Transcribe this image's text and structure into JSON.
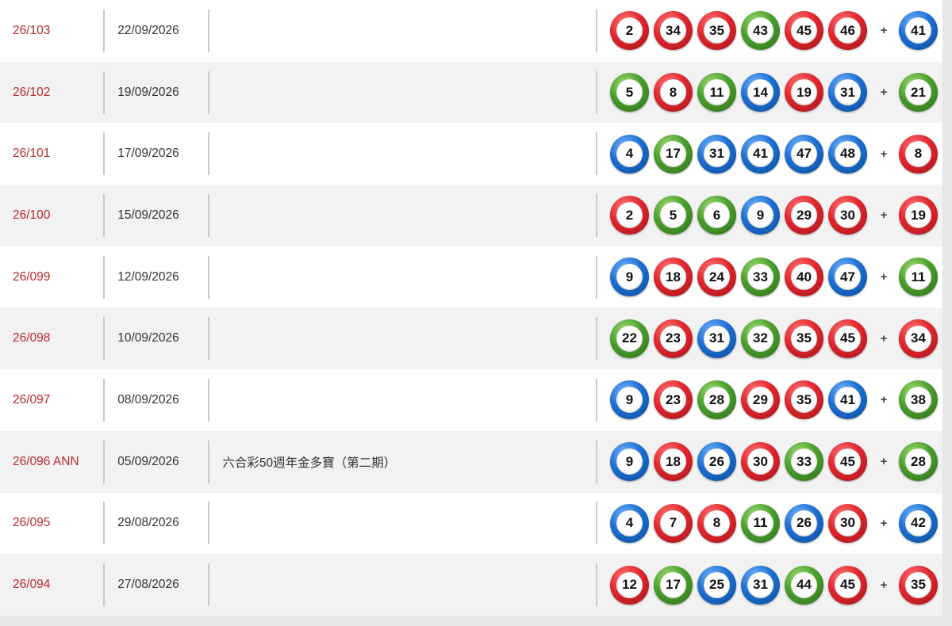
{
  "rows": [
    {
      "draw": "26/103",
      "date": "22/09/2026",
      "note": "",
      "balls": [
        {
          "n": "2",
          "c": "red"
        },
        {
          "n": "34",
          "c": "red"
        },
        {
          "n": "35",
          "c": "red"
        },
        {
          "n": "43",
          "c": "green"
        },
        {
          "n": "45",
          "c": "red"
        },
        {
          "n": "46",
          "c": "red"
        }
      ],
      "extra": {
        "n": "41",
        "c": "blue"
      }
    },
    {
      "draw": "26/102",
      "date": "19/09/2026",
      "note": "",
      "balls": [
        {
          "n": "5",
          "c": "green"
        },
        {
          "n": "8",
          "c": "red"
        },
        {
          "n": "11",
          "c": "green"
        },
        {
          "n": "14",
          "c": "blue"
        },
        {
          "n": "19",
          "c": "red"
        },
        {
          "n": "31",
          "c": "blue"
        }
      ],
      "extra": {
        "n": "21",
        "c": "green"
      }
    },
    {
      "draw": "26/101",
      "date": "17/09/2026",
      "note": "",
      "balls": [
        {
          "n": "4",
          "c": "blue"
        },
        {
          "n": "17",
          "c": "green"
        },
        {
          "n": "31",
          "c": "blue"
        },
        {
          "n": "41",
          "c": "blue"
        },
        {
          "n": "47",
          "c": "blue"
        },
        {
          "n": "48",
          "c": "blue"
        }
      ],
      "extra": {
        "n": "8",
        "c": "red"
      }
    },
    {
      "draw": "26/100",
      "date": "15/09/2026",
      "note": "",
      "balls": [
        {
          "n": "2",
          "c": "red"
        },
        {
          "n": "5",
          "c": "green"
        },
        {
          "n": "6",
          "c": "green"
        },
        {
          "n": "9",
          "c": "blue"
        },
        {
          "n": "29",
          "c": "red"
        },
        {
          "n": "30",
          "c": "red"
        }
      ],
      "extra": {
        "n": "19",
        "c": "red"
      }
    },
    {
      "draw": "26/099",
      "date": "12/09/2026",
      "note": "",
      "balls": [
        {
          "n": "9",
          "c": "blue"
        },
        {
          "n": "18",
          "c": "red"
        },
        {
          "n": "24",
          "c": "red"
        },
        {
          "n": "33",
          "c": "green"
        },
        {
          "n": "40",
          "c": "red"
        },
        {
          "n": "47",
          "c": "blue"
        }
      ],
      "extra": {
        "n": "11",
        "c": "green"
      }
    },
    {
      "draw": "26/098",
      "date": "10/09/2026",
      "note": "",
      "balls": [
        {
          "n": "22",
          "c": "green"
        },
        {
          "n": "23",
          "c": "red"
        },
        {
          "n": "31",
          "c": "blue"
        },
        {
          "n": "32",
          "c": "green"
        },
        {
          "n": "35",
          "c": "red"
        },
        {
          "n": "45",
          "c": "red"
        }
      ],
      "extra": {
        "n": "34",
        "c": "red"
      }
    },
    {
      "draw": "26/097",
      "date": "08/09/2026",
      "note": "",
      "balls": [
        {
          "n": "9",
          "c": "blue"
        },
        {
          "n": "23",
          "c": "red"
        },
        {
          "n": "28",
          "c": "green"
        },
        {
          "n": "29",
          "c": "red"
        },
        {
          "n": "35",
          "c": "red"
        },
        {
          "n": "41",
          "c": "blue"
        }
      ],
      "extra": {
        "n": "38",
        "c": "green"
      }
    },
    {
      "draw": "26/096 ANN",
      "date": "05/09/2026",
      "note": "六合彩50週年金多寶（第二期）",
      "balls": [
        {
          "n": "9",
          "c": "blue"
        },
        {
          "n": "18",
          "c": "red"
        },
        {
          "n": "26",
          "c": "blue"
        },
        {
          "n": "30",
          "c": "red"
        },
        {
          "n": "33",
          "c": "green"
        },
        {
          "n": "45",
          "c": "red"
        }
      ],
      "extra": {
        "n": "28",
        "c": "green"
      }
    },
    {
      "draw": "26/095",
      "date": "29/08/2026",
      "note": "",
      "balls": [
        {
          "n": "4",
          "c": "blue"
        },
        {
          "n": "7",
          "c": "red"
        },
        {
          "n": "8",
          "c": "red"
        },
        {
          "n": "11",
          "c": "green"
        },
        {
          "n": "26",
          "c": "blue"
        },
        {
          "n": "30",
          "c": "red"
        }
      ],
      "extra": {
        "n": "42",
        "c": "blue"
      }
    },
    {
      "draw": "26/094",
      "date": "27/08/2026",
      "note": "",
      "balls": [
        {
          "n": "12",
          "c": "red"
        },
        {
          "n": "17",
          "c": "green"
        },
        {
          "n": "25",
          "c": "blue"
        },
        {
          "n": "31",
          "c": "blue"
        },
        {
          "n": "44",
          "c": "green"
        },
        {
          "n": "45",
          "c": "red"
        }
      ],
      "extra": {
        "n": "35",
        "c": "red"
      }
    }
  ],
  "plus_symbol": "+",
  "colors": {
    "draw_link": "#b72b2b",
    "row_alt": "#f2f2f2",
    "separator": "#c8c8c8"
  }
}
